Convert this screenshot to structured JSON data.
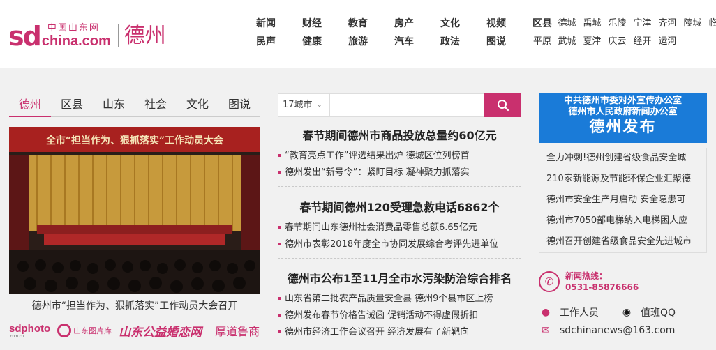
{
  "logo": {
    "sd": "sd",
    "china_text": "中国山东网",
    "domain": "china.com",
    "city": "德州"
  },
  "nav": {
    "items": [
      "新闻",
      "财经",
      "教育",
      "房产",
      "文化",
      "视频",
      "民声",
      "健康",
      "旅游",
      "汽车",
      "政法",
      "图说"
    ]
  },
  "counties": {
    "items": [
      "区县",
      "德城",
      "禹城",
      "乐陵",
      "宁津",
      "齐河",
      "陵城",
      "临邑",
      "平原",
      "武城",
      "夏津",
      "庆云",
      "经开",
      "运河"
    ]
  },
  "left": {
    "tabs": [
      "德州",
      "区县",
      "山东",
      "社会",
      "文化",
      "图说"
    ],
    "active_tab": 0,
    "photo_banner": "全市“担当作为、狠抓落实”工作动员大会",
    "caption": "德州市“担当作为、狠抓落实”工作动员大会召开",
    "partners": {
      "p1": "sdphoto",
      "p1_sub": ".com.cn",
      "p2": "山东图片库",
      "p3": "山东公益婚恋网",
      "p4": "厚道鲁商"
    }
  },
  "search": {
    "city_label": "17城市",
    "placeholder": ""
  },
  "news": [
    {
      "headline": "春节期间德州市商品投放总量约60亿元",
      "items": [
        "“教育亮点工作”评选结果出炉 德城区位列榜首",
        "德州发出“新号令”：紧盯目标 凝神聚力抓落实"
      ]
    },
    {
      "headline": "春节期间德州120受理急救电话6862个",
      "items": [
        "春节期间山东德州社会消费品零售总额6.65亿元",
        "德州市表彰2018年度全市协同发展综合考评先进单位"
      ]
    },
    {
      "headline": "德州市公布1至11月全市水污染防治综合排名",
      "items": [
        "山东省第二批农产品质量安全县 德州9个县市区上榜",
        "德州发布春节价格告诫函 促销活动不得虚假折扣",
        "德州市经济工作会议召开 经济发展有了新靶向"
      ]
    }
  ],
  "right": {
    "banner": {
      "line1": "中共德州市委对外宣传办公室",
      "line2": "德州市人民政府新闻办公室",
      "big": "德州发布"
    },
    "list": [
      "全力冲刺!德州创建省级食品安全城",
      "210家新能源及节能环保企业汇聚德",
      "德州市安全生产月启动 安全隐患可",
      "德州市7050部电梯纳入电梯困人应",
      "德州召开创建省级食品安全先进城市"
    ],
    "hotline": {
      "label": "新闻热线：",
      "number": "0531-85876666"
    },
    "contacts": {
      "staff": "工作人员",
      "qq": "值班QQ",
      "email": "sdchinanews@163.com"
    }
  },
  "colors": {
    "brand": "#c9306e",
    "banner_blue": "#1a7bd8"
  }
}
